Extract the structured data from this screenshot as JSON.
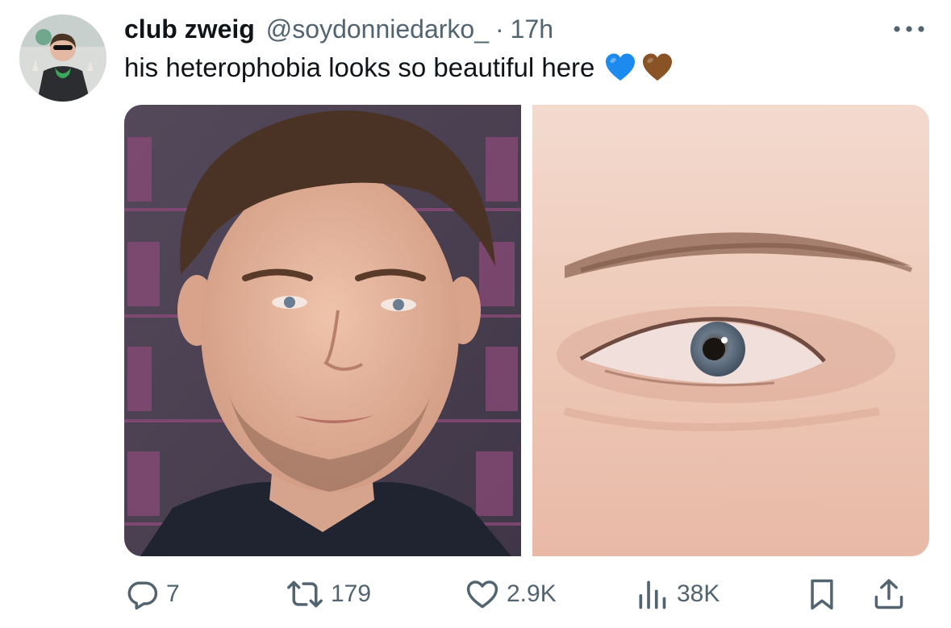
{
  "author": {
    "display_name": "club zweig",
    "handle": "@soydonniedarko_",
    "separator": "·",
    "timestamp": "17h"
  },
  "tweet": {
    "text": "his heterophobia looks so beautiful here",
    "emojis": [
      "blue-heart",
      "brown-heart"
    ]
  },
  "media": {
    "count": 2
  },
  "actions": {
    "replies": "7",
    "retweets": "179",
    "likes": "2.9K",
    "views": "38K"
  },
  "icons": {
    "reply": "speech-bubble-icon",
    "retweet": "retweet-arrows-icon",
    "like": "heart-outline-icon",
    "views": "bar-chart-icon",
    "bookmark": "bookmark-icon",
    "share": "upload-share-icon",
    "more": "ellipsis-icon"
  },
  "colors": {
    "text_primary": "#0f1419",
    "text_secondary": "#536471",
    "blue_heart": "#1d8af0",
    "brown_heart": "#8a5326"
  }
}
